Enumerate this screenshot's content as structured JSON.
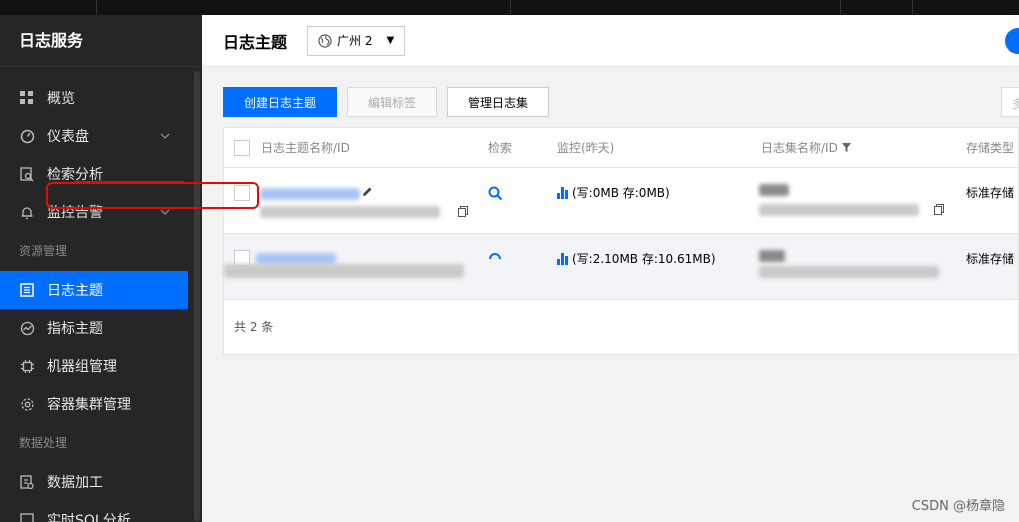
{
  "sidebar": {
    "title": "日志服务",
    "items": [
      {
        "label": "概览",
        "icon": "grid-icon"
      },
      {
        "label": "仪表盘",
        "icon": "dashboard-icon"
      },
      {
        "label": "检索分析",
        "icon": "search-doc-icon"
      },
      {
        "label": "监控告警",
        "icon": "bell-icon"
      }
    ],
    "group1": "资源管理",
    "items2": [
      {
        "label": "日志主题",
        "icon": "log-topic-icon"
      },
      {
        "label": "指标主题",
        "icon": "metric-icon"
      },
      {
        "label": "机器组管理",
        "icon": "chip-icon"
      },
      {
        "label": "容器集群管理",
        "icon": "gear-icon"
      }
    ],
    "group2": "数据处理",
    "items3": [
      {
        "label": "数据加工",
        "icon": "data-process-icon"
      },
      {
        "label": "实时SQL分析",
        "icon": "sql-icon"
      }
    ]
  },
  "header": {
    "title": "日志主题",
    "region": "广州 2"
  },
  "toolbar": {
    "create": "创建日志主题",
    "edit_tags": "编辑标签",
    "manage_set": "管理日志集",
    "more_stub": "多"
  },
  "table": {
    "columns": [
      "日志主题名称/ID",
      "检索",
      "监控(昨天)",
      "日志集名称/ID",
      "存储类型"
    ],
    "rows": [
      {
        "monitor": "(写:0MB  存:0MB)",
        "storage": "标准存储"
      },
      {
        "monitor": "(写:2.10MB  存:10.61MB)",
        "storage": "标准存储"
      }
    ],
    "total": "共 2 条"
  },
  "colors": {
    "accent": "#006eff",
    "sidebar_bg": "#262626",
    "highlight": "#e10b0b"
  },
  "watermark": "CSDN @杨章隐"
}
